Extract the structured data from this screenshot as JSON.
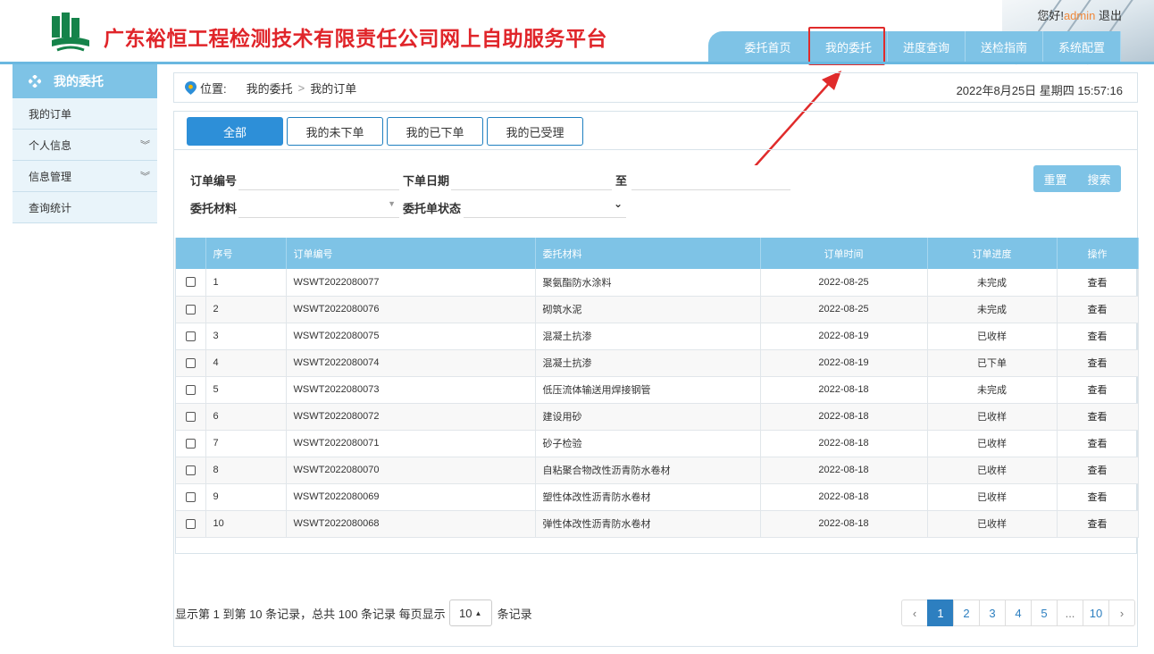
{
  "header": {
    "site_title": "广东裕恒工程检测技术有限责任公司网上自助服务平台",
    "greeting": "您好!",
    "username": "admin",
    "logout": "退出"
  },
  "nav": {
    "items": [
      "委托首页",
      "我的委托",
      "进度查询",
      "送检指南",
      "系统配置"
    ],
    "active_index": 1
  },
  "sidebar": {
    "title": "我的委托",
    "items": [
      {
        "label": "我的订单",
        "expandable": false
      },
      {
        "label": "个人信息",
        "expandable": true
      },
      {
        "label": "信息管理",
        "expandable": true
      },
      {
        "label": "查询统计",
        "expandable": false
      }
    ]
  },
  "breadcrumb": {
    "label": "位置:",
    "path": [
      "我的委托",
      "我的订单"
    ],
    "separator": ">",
    "datetime": "2022年8月25日 星期四 15:57:16"
  },
  "tabs": [
    "全部",
    "我的未下单",
    "我的已下单",
    "我的已受理"
  ],
  "filters": {
    "order_no_label": "订单编号",
    "order_date_label": "下单日期",
    "to_label": "至",
    "material_label": "委托材料",
    "status_label": "委托单状态",
    "reset": "重置",
    "search": "搜索"
  },
  "table": {
    "headers": [
      "序号",
      "订单编号",
      "委托材料",
      "订单时间",
      "订单进度",
      "操作"
    ],
    "rows": [
      {
        "no": "1",
        "order_no": "WSWT2022080077",
        "material": "聚氨酯防水涂料",
        "time": "2022-08-25",
        "progress": "未完成",
        "action": "查看"
      },
      {
        "no": "2",
        "order_no": "WSWT2022080076",
        "material": "砌筑水泥",
        "time": "2022-08-25",
        "progress": "未完成",
        "action": "查看"
      },
      {
        "no": "3",
        "order_no": "WSWT2022080075",
        "material": "混凝土抗渗",
        "time": "2022-08-19",
        "progress": "已收样",
        "action": "查看"
      },
      {
        "no": "4",
        "order_no": "WSWT2022080074",
        "material": "混凝土抗渗",
        "time": "2022-08-19",
        "progress": "已下单",
        "action": "查看"
      },
      {
        "no": "5",
        "order_no": "WSWT2022080073",
        "material": "低压流体输送用焊接钢管",
        "time": "2022-08-18",
        "progress": "未完成",
        "action": "查看"
      },
      {
        "no": "6",
        "order_no": "WSWT2022080072",
        "material": "建设用砂",
        "time": "2022-08-18",
        "progress": "已收样",
        "action": "查看"
      },
      {
        "no": "7",
        "order_no": "WSWT2022080071",
        "material": "砂子检验",
        "time": "2022-08-18",
        "progress": "已收样",
        "action": "查看"
      },
      {
        "no": "8",
        "order_no": "WSWT2022080070",
        "material": "自粘聚合物改性沥青防水卷材",
        "time": "2022-08-18",
        "progress": "已收样",
        "action": "查看"
      },
      {
        "no": "9",
        "order_no": "WSWT2022080069",
        "material": "塑性体改性沥青防水卷材",
        "time": "2022-08-18",
        "progress": "已收样",
        "action": "查看"
      },
      {
        "no": "10",
        "order_no": "WSWT2022080068",
        "material": "弹性体改性沥青防水卷材",
        "time": "2022-08-18",
        "progress": "已收样",
        "action": "查看"
      }
    ]
  },
  "pager": {
    "info_prefix": "显示第 1 到第 10 条记录，总共 100 条记录 每页显示",
    "page_size": "10",
    "info_suffix": "条记录",
    "prev": "‹",
    "next": "›",
    "pages": [
      "1",
      "2",
      "3",
      "4",
      "5",
      "...",
      "10"
    ],
    "active_page": "1"
  },
  "colors": {
    "accent": "#7ec3e6",
    "title_red": "#e0252a",
    "active_tab": "#2d8fd8",
    "annotation_red": "#e02b2b"
  }
}
